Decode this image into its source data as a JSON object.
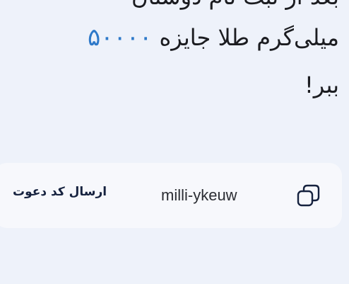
{
  "reward": {
    "line_cut": "بعد از ثبت نام دوستان",
    "amount": "۵۰۰۰۰",
    "line1_text": "میلی‌گرم طلا جایزه",
    "line2_text": "ببر!"
  },
  "invite": {
    "send_label": "ارسال کد دعوت",
    "code": "milli-ykeuw",
    "copy_icon": "copy-icon"
  },
  "colors": {
    "background": "#eef2fa",
    "card": "#f7f8fc",
    "accent": "#2e79c9",
    "text": "#1b1c20",
    "button_text": "#16223f"
  }
}
